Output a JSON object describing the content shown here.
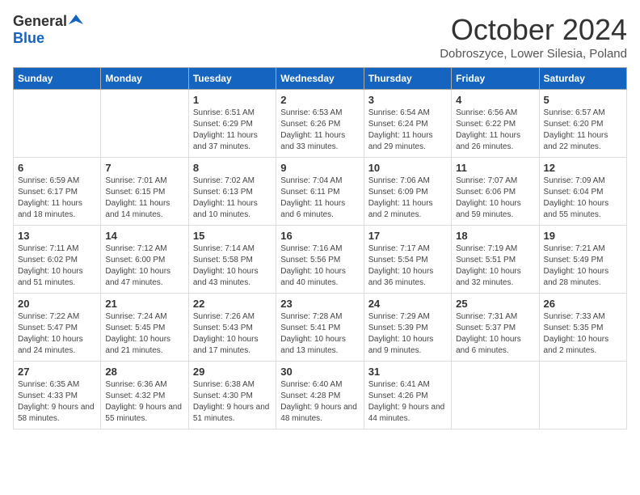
{
  "logo": {
    "general": "General",
    "blue": "Blue"
  },
  "title": "October 2024",
  "location": "Dobroszyce, Lower Silesia, Poland",
  "days_of_week": [
    "Sunday",
    "Monday",
    "Tuesday",
    "Wednesday",
    "Thursday",
    "Friday",
    "Saturday"
  ],
  "weeks": [
    [
      {
        "num": "",
        "sunrise": "",
        "sunset": "",
        "daylight": "",
        "empty": true
      },
      {
        "num": "",
        "sunrise": "",
        "sunset": "",
        "daylight": "",
        "empty": true
      },
      {
        "num": "1",
        "sunrise": "Sunrise: 6:51 AM",
        "sunset": "Sunset: 6:29 PM",
        "daylight": "Daylight: 11 hours and 37 minutes.",
        "empty": false
      },
      {
        "num": "2",
        "sunrise": "Sunrise: 6:53 AM",
        "sunset": "Sunset: 6:26 PM",
        "daylight": "Daylight: 11 hours and 33 minutes.",
        "empty": false
      },
      {
        "num": "3",
        "sunrise": "Sunrise: 6:54 AM",
        "sunset": "Sunset: 6:24 PM",
        "daylight": "Daylight: 11 hours and 29 minutes.",
        "empty": false
      },
      {
        "num": "4",
        "sunrise": "Sunrise: 6:56 AM",
        "sunset": "Sunset: 6:22 PM",
        "daylight": "Daylight: 11 hours and 26 minutes.",
        "empty": false
      },
      {
        "num": "5",
        "sunrise": "Sunrise: 6:57 AM",
        "sunset": "Sunset: 6:20 PM",
        "daylight": "Daylight: 11 hours and 22 minutes.",
        "empty": false
      }
    ],
    [
      {
        "num": "6",
        "sunrise": "Sunrise: 6:59 AM",
        "sunset": "Sunset: 6:17 PM",
        "daylight": "Daylight: 11 hours and 18 minutes.",
        "empty": false
      },
      {
        "num": "7",
        "sunrise": "Sunrise: 7:01 AM",
        "sunset": "Sunset: 6:15 PM",
        "daylight": "Daylight: 11 hours and 14 minutes.",
        "empty": false
      },
      {
        "num": "8",
        "sunrise": "Sunrise: 7:02 AM",
        "sunset": "Sunset: 6:13 PM",
        "daylight": "Daylight: 11 hours and 10 minutes.",
        "empty": false
      },
      {
        "num": "9",
        "sunrise": "Sunrise: 7:04 AM",
        "sunset": "Sunset: 6:11 PM",
        "daylight": "Daylight: 11 hours and 6 minutes.",
        "empty": false
      },
      {
        "num": "10",
        "sunrise": "Sunrise: 7:06 AM",
        "sunset": "Sunset: 6:09 PM",
        "daylight": "Daylight: 11 hours and 2 minutes.",
        "empty": false
      },
      {
        "num": "11",
        "sunrise": "Sunrise: 7:07 AM",
        "sunset": "Sunset: 6:06 PM",
        "daylight": "Daylight: 10 hours and 59 minutes.",
        "empty": false
      },
      {
        "num": "12",
        "sunrise": "Sunrise: 7:09 AM",
        "sunset": "Sunset: 6:04 PM",
        "daylight": "Daylight: 10 hours and 55 minutes.",
        "empty": false
      }
    ],
    [
      {
        "num": "13",
        "sunrise": "Sunrise: 7:11 AM",
        "sunset": "Sunset: 6:02 PM",
        "daylight": "Daylight: 10 hours and 51 minutes.",
        "empty": false
      },
      {
        "num": "14",
        "sunrise": "Sunrise: 7:12 AM",
        "sunset": "Sunset: 6:00 PM",
        "daylight": "Daylight: 10 hours and 47 minutes.",
        "empty": false
      },
      {
        "num": "15",
        "sunrise": "Sunrise: 7:14 AM",
        "sunset": "Sunset: 5:58 PM",
        "daylight": "Daylight: 10 hours and 43 minutes.",
        "empty": false
      },
      {
        "num": "16",
        "sunrise": "Sunrise: 7:16 AM",
        "sunset": "Sunset: 5:56 PM",
        "daylight": "Daylight: 10 hours and 40 minutes.",
        "empty": false
      },
      {
        "num": "17",
        "sunrise": "Sunrise: 7:17 AM",
        "sunset": "Sunset: 5:54 PM",
        "daylight": "Daylight: 10 hours and 36 minutes.",
        "empty": false
      },
      {
        "num": "18",
        "sunrise": "Sunrise: 7:19 AM",
        "sunset": "Sunset: 5:51 PM",
        "daylight": "Daylight: 10 hours and 32 minutes.",
        "empty": false
      },
      {
        "num": "19",
        "sunrise": "Sunrise: 7:21 AM",
        "sunset": "Sunset: 5:49 PM",
        "daylight": "Daylight: 10 hours and 28 minutes.",
        "empty": false
      }
    ],
    [
      {
        "num": "20",
        "sunrise": "Sunrise: 7:22 AM",
        "sunset": "Sunset: 5:47 PM",
        "daylight": "Daylight: 10 hours and 24 minutes.",
        "empty": false
      },
      {
        "num": "21",
        "sunrise": "Sunrise: 7:24 AM",
        "sunset": "Sunset: 5:45 PM",
        "daylight": "Daylight: 10 hours and 21 minutes.",
        "empty": false
      },
      {
        "num": "22",
        "sunrise": "Sunrise: 7:26 AM",
        "sunset": "Sunset: 5:43 PM",
        "daylight": "Daylight: 10 hours and 17 minutes.",
        "empty": false
      },
      {
        "num": "23",
        "sunrise": "Sunrise: 7:28 AM",
        "sunset": "Sunset: 5:41 PM",
        "daylight": "Daylight: 10 hours and 13 minutes.",
        "empty": false
      },
      {
        "num": "24",
        "sunrise": "Sunrise: 7:29 AM",
        "sunset": "Sunset: 5:39 PM",
        "daylight": "Daylight: 10 hours and 9 minutes.",
        "empty": false
      },
      {
        "num": "25",
        "sunrise": "Sunrise: 7:31 AM",
        "sunset": "Sunset: 5:37 PM",
        "daylight": "Daylight: 10 hours and 6 minutes.",
        "empty": false
      },
      {
        "num": "26",
        "sunrise": "Sunrise: 7:33 AM",
        "sunset": "Sunset: 5:35 PM",
        "daylight": "Daylight: 10 hours and 2 minutes.",
        "empty": false
      }
    ],
    [
      {
        "num": "27",
        "sunrise": "Sunrise: 6:35 AM",
        "sunset": "Sunset: 4:33 PM",
        "daylight": "Daylight: 9 hours and 58 minutes.",
        "empty": false
      },
      {
        "num": "28",
        "sunrise": "Sunrise: 6:36 AM",
        "sunset": "Sunset: 4:32 PM",
        "daylight": "Daylight: 9 hours and 55 minutes.",
        "empty": false
      },
      {
        "num": "29",
        "sunrise": "Sunrise: 6:38 AM",
        "sunset": "Sunset: 4:30 PM",
        "daylight": "Daylight: 9 hours and 51 minutes.",
        "empty": false
      },
      {
        "num": "30",
        "sunrise": "Sunrise: 6:40 AM",
        "sunset": "Sunset: 4:28 PM",
        "daylight": "Daylight: 9 hours and 48 minutes.",
        "empty": false
      },
      {
        "num": "31",
        "sunrise": "Sunrise: 6:41 AM",
        "sunset": "Sunset: 4:26 PM",
        "daylight": "Daylight: 9 hours and 44 minutes.",
        "empty": false
      },
      {
        "num": "",
        "sunrise": "",
        "sunset": "",
        "daylight": "",
        "empty": true
      },
      {
        "num": "",
        "sunrise": "",
        "sunset": "",
        "daylight": "",
        "empty": true
      }
    ]
  ]
}
